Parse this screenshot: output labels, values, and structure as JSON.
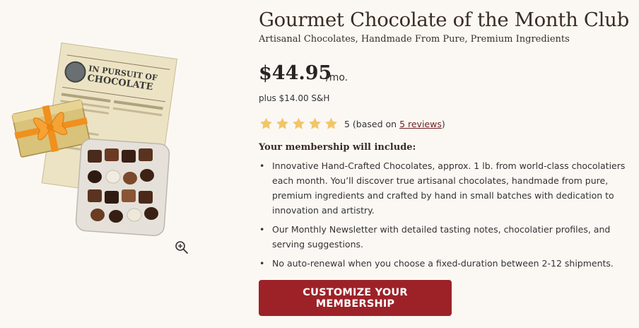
{
  "product": {
    "title": "Gourmet Chocolate of the Month Club",
    "subtitle": "Artisanal Chocolates, Handmade From Pure, Premium Ingredients",
    "image_alt": "Chocolate assortment with newsletter and gift box",
    "newsletter_headline": "IN PURSUIT OF CHOCOLATE"
  },
  "pricing": {
    "price": "$44.95",
    "period": "/mo.",
    "shipping": "plus $14.00 S&H"
  },
  "rating": {
    "stars": 5,
    "max_stars": 5,
    "score_prefix": "5 (based on ",
    "reviews_link": "5 reviews",
    "score_suffix": ")",
    "star_color": "#f2c56b"
  },
  "includes": {
    "heading": "Your membership will include:",
    "items": [
      "Innovative Hand-Crafted Chocolates, approx. 1 lb. from world-class chocolatiers each month. You’ll discover true artisanal chocolates, handmade from pure, premium ingredients and crafted by hand in small batches with dedication to innovation and artistry.",
      "Our Monthly Newsletter with detailed tasting notes, chocolatier profiles, and serving suggestions.",
      "No auto-renewal when you choose a fixed-duration between 2-12 shipments."
    ]
  },
  "cta": {
    "label": "CUSTOMIZE YOUR MEMBERSHIP",
    "color": "#9d2228"
  },
  "icons": {
    "zoom": "zoom-in-icon",
    "star": "star-icon"
  }
}
